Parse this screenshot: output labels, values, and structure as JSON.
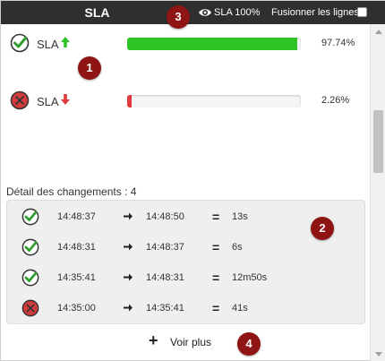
{
  "header": {
    "title": "SLA",
    "sla100_label": "SLA 100%",
    "merge_label": "Fusionner les lignes"
  },
  "badges": [
    "1",
    "2",
    "3",
    "4"
  ],
  "sla_rows": [
    {
      "label": "SLA",
      "status": "ok",
      "trend": "up",
      "percent_text": "97.74%",
      "percent_value": 97.74,
      "fill_color": "#2ec425"
    },
    {
      "label": "SLA",
      "status": "ko",
      "trend": "down",
      "percent_text": "2.26%",
      "percent_value": 2.26,
      "fill_color": "#e23a3a"
    }
  ],
  "detail": {
    "title": "Détail des changements : 4",
    "rows": [
      {
        "status": "ok",
        "start": "14:48:37",
        "end": "14:48:50",
        "duration": "13s"
      },
      {
        "status": "ok",
        "start": "14:48:31",
        "end": "14:48:37",
        "duration": "6s"
      },
      {
        "status": "ok",
        "start": "14:35:41",
        "end": "14:48:31",
        "duration": "12m50s"
      },
      {
        "status": "ko",
        "start": "14:35:00",
        "end": "14:35:41",
        "duration": "41s"
      }
    ],
    "equals": "="
  },
  "voir_plus": {
    "plus": "+",
    "label": "Voir plus"
  },
  "colors": {
    "ok_green": "#2f9e2f",
    "ko_red": "#d33c3c",
    "badge": "#8f1414",
    "header_bg": "#2f2f2f"
  },
  "icons": {
    "ok": "check-circle-icon",
    "ko": "cross-circle-icon",
    "eye": "eye-icon",
    "up": "arrow-up-icon",
    "down": "arrow-down-icon",
    "arrow": "arrow-right-icon"
  }
}
